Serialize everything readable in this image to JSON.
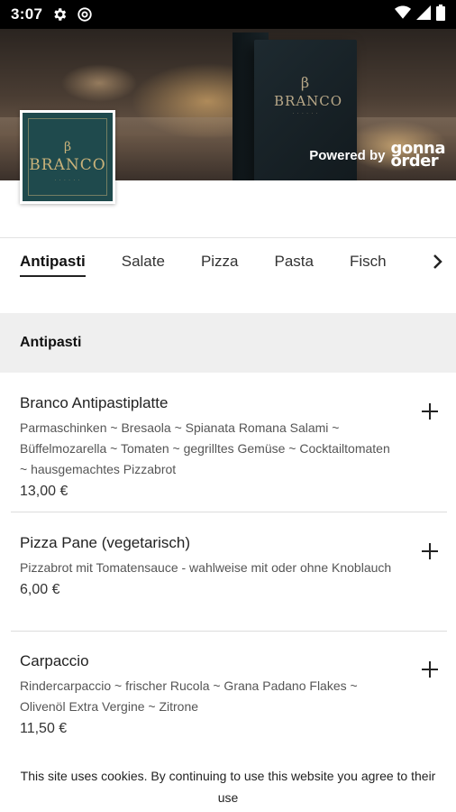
{
  "status_bar": {
    "time": "3:07",
    "icons_left": [
      "gear-icon",
      "at-sign-icon"
    ],
    "icons_right": [
      "wifi-icon",
      "signal-icon",
      "battery-icon"
    ]
  },
  "hero": {
    "menu_card_logo": "BRANCO",
    "powered_by": "Powered by",
    "brand_top": "gonna",
    "brand_bottom": "order"
  },
  "restaurant_logo": {
    "name": "BRANCO"
  },
  "tabs": [
    {
      "label": "Antipasti",
      "active": true
    },
    {
      "label": "Salate",
      "active": false
    },
    {
      "label": "Pizza",
      "active": false
    },
    {
      "label": "Pasta",
      "active": false
    },
    {
      "label": "Fisch",
      "active": false
    }
  ],
  "section": {
    "title": "Antipasti"
  },
  "items": [
    {
      "title": "Branco Antipastiplatte",
      "description": "Parmaschinken ~ Bresaola ~ Spianata Romana Salami ~ Büffelmozarella ~ Tomaten ~ gegrilltes Gemüse ~ Cocktailtomaten ~ hausgemachtes Pizzabrot",
      "price": "13,00 €"
    },
    {
      "title": "Pizza Pane (vegetarisch)",
      "description": "Pizzabrot mit Tomatensauce - wahlweise mit oder ohne Knoblauch",
      "price": "6,00 €"
    },
    {
      "title": "Carpaccio",
      "description": "Rindercarpaccio ~ frischer Rucola ~ Grana Padano Flakes ~ Olivenöl Extra Vergine ~ Zitrone",
      "price": "11,50 €"
    }
  ],
  "cookie_banner": {
    "text": "This site uses cookies. By continuing to use this website you agree to their use"
  }
}
